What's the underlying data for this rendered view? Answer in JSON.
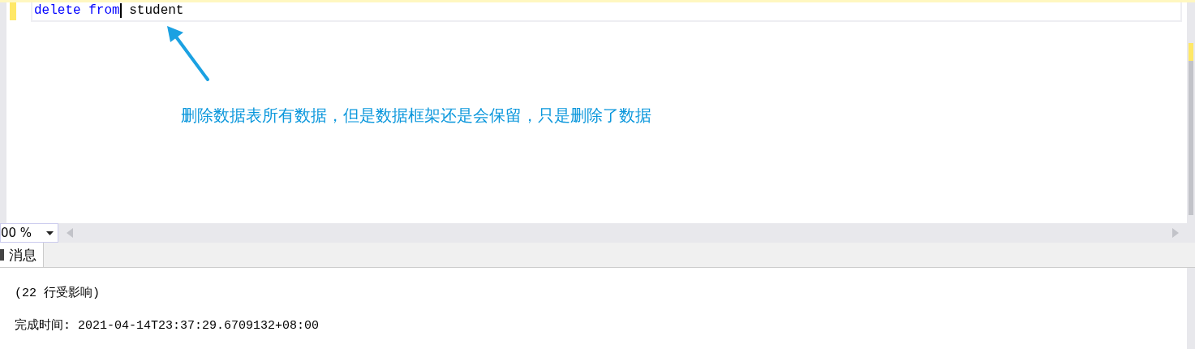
{
  "editor": {
    "tokens": [
      {
        "text": "delete",
        "kind": "keyword"
      },
      {
        "text": "from",
        "kind": "keyword"
      },
      {
        "text": "student",
        "kind": "plain"
      }
    ],
    "annotation": "删除数据表所有数据，但是数据框架还是会保留，只是删除了数据"
  },
  "zoom": {
    "value": "00 %"
  },
  "tabs": [
    {
      "label": "消息",
      "selected": true
    }
  ],
  "messages": [
    "(22 行受影响)",
    "完成时间: 2021-04-14T23:37:29.6709132+08:00"
  ]
}
